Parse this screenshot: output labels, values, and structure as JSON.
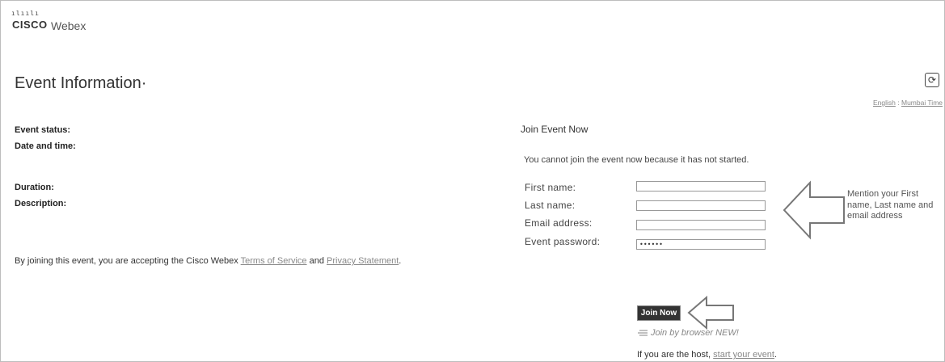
{
  "brand": {
    "logo_bars": "ılıılı",
    "cisco": "CISCO",
    "product": "Webex"
  },
  "page": {
    "title": "Event Information·"
  },
  "toolbar": {
    "refresh_icon": "refresh-icon",
    "refresh_glyph": "⟳"
  },
  "top_links": {
    "language": "English",
    "separator": ":",
    "timezone": "Mumbai Time"
  },
  "event_fields": {
    "status": "Event status:",
    "datetime": "Date and time:",
    "duration": "Duration:",
    "description": "Description:"
  },
  "terms": {
    "prefix": "By joining this event, you are accepting the Cisco Webex ",
    "tos": "Terms of Service",
    "and": " and ",
    "privacy": "Privacy Statement",
    "suffix": "."
  },
  "join": {
    "heading": "Join Event Now",
    "notice": "You cannot join the event now because it has not started.",
    "fields": {
      "first_name": {
        "label": "First name:",
        "value": ""
      },
      "last_name": {
        "label": "Last name:",
        "value": ""
      },
      "email": {
        "label": "Email address:",
        "value": ""
      },
      "password": {
        "label": "Event password:",
        "value": "••••••"
      }
    },
    "join_button": "Join Now",
    "browser_link": "Join by browser  NEW!",
    "host_prefix": "If you are the host, ",
    "host_link": "start your event",
    "host_suffix": "."
  },
  "annotation": {
    "text": "Mention your First name, Last name and email address"
  },
  "colors": {
    "arrow": "#777777",
    "link": "#888888",
    "button": "#333333"
  }
}
